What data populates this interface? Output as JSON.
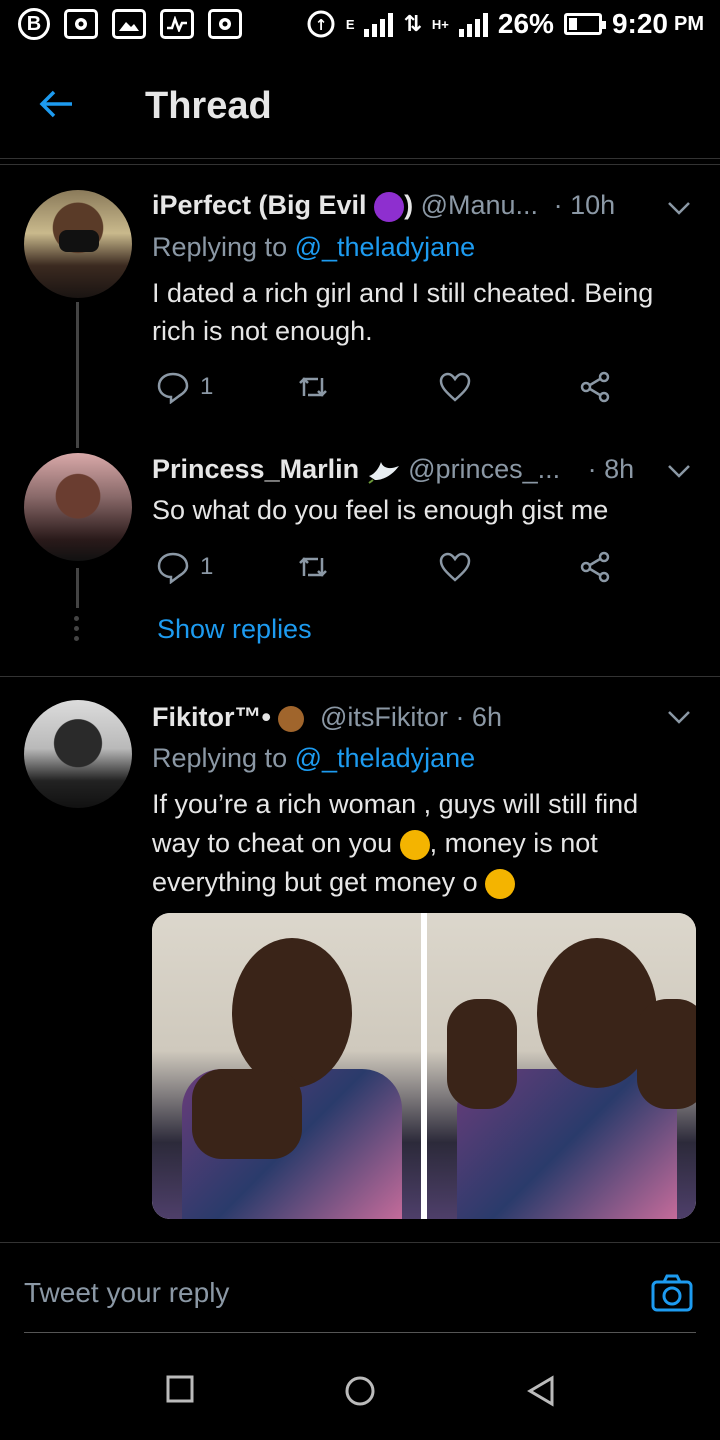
{
  "status_bar": {
    "left_icons": [
      "b-badge-icon",
      "notification-icon",
      "gallery-icon",
      "chart-icon",
      "notification-icon"
    ],
    "signal_label": "E",
    "network_label": "H+",
    "battery": "26%",
    "time": "9:20",
    "ampm": "PM"
  },
  "header": {
    "title": "Thread"
  },
  "tweets": [
    {
      "name": "iPerfect (Big Evil",
      "name_suffix": ")",
      "handle": "@Manu...",
      "time": "· 10h",
      "replying_prefix": "Replying to",
      "replying_to": "@_theladyjane",
      "text": "I dated a rich girl and I still cheated. Being rich is not enough.",
      "reply_count": "1"
    },
    {
      "name": "Princess_Marlin",
      "handle": "@princes_...",
      "time": "· 8h",
      "text": "So what do you feel is enough gist me",
      "reply_count": "1"
    },
    {
      "name": "Fikitor™",
      "name_sep": "•",
      "handle": "@itsFikitor",
      "time": "· 6h",
      "replying_prefix": "Replying to",
      "replying_to": "@_theladyjane",
      "text_line1": "If you’re a rich woman , guys will still find",
      "text_line2a": "way to cheat on you",
      "text_line2b": ", money is not",
      "text_line3": "everything but get money o"
    }
  ],
  "show_replies": "Show replies",
  "reply_bar": {
    "placeholder": "Tweet your reply"
  },
  "colors": {
    "background": "#000000",
    "accent": "#1d9bf0",
    "secondary_text": "#8b98a5",
    "primary_text": "#e6e6e6"
  }
}
